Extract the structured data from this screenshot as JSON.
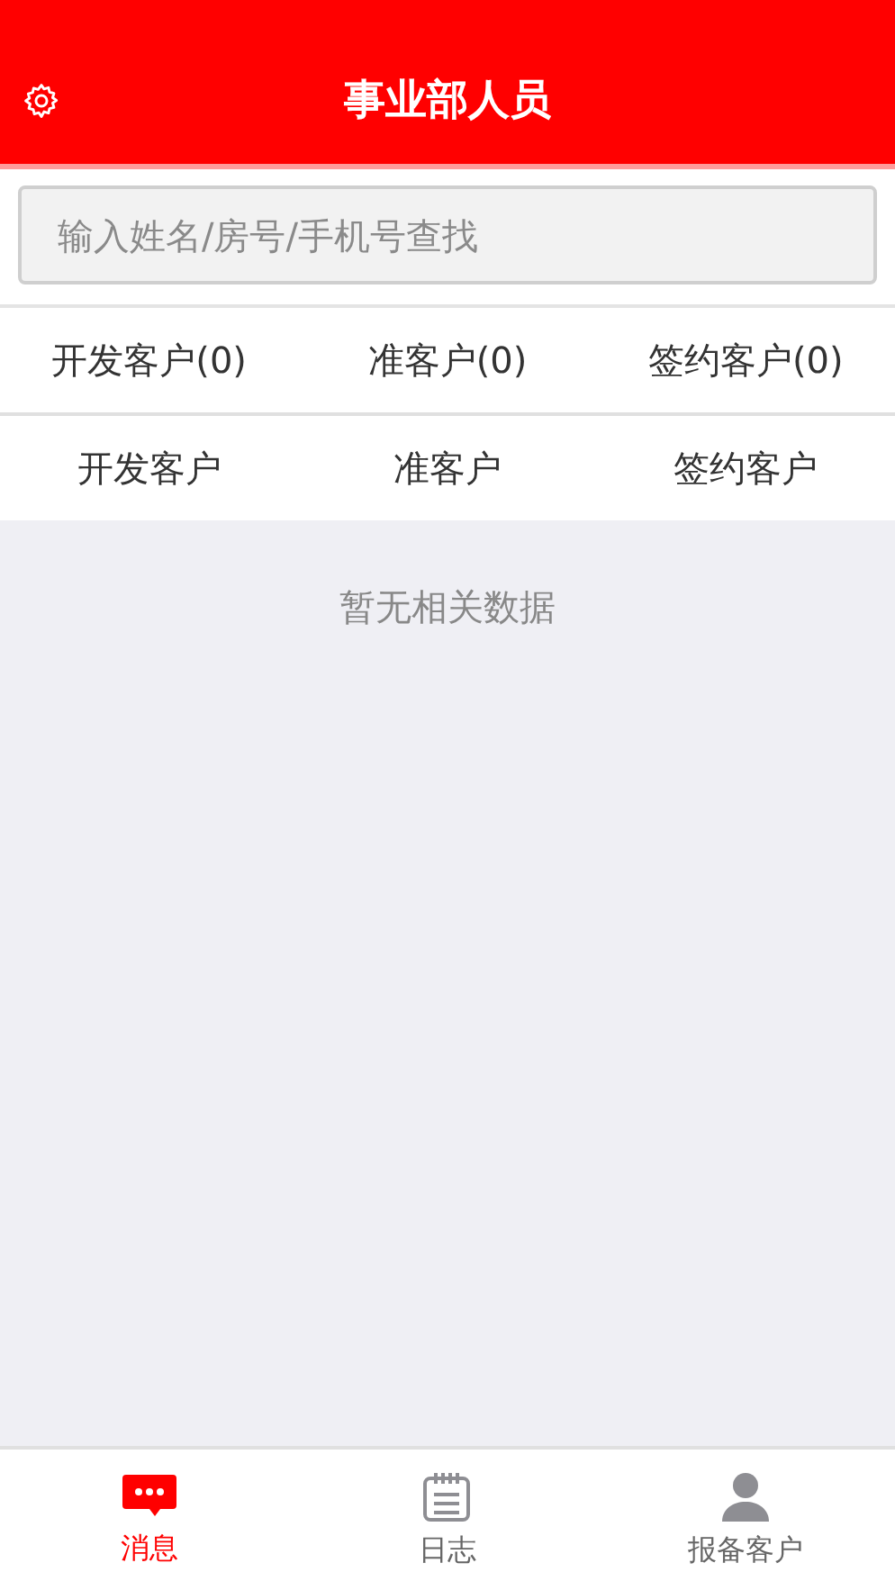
{
  "header": {
    "title": "事业部人员"
  },
  "search": {
    "placeholder": "输入姓名/房号/手机号查找"
  },
  "counts": [
    "开发客户(0)",
    "准客户(0)",
    "签约客户(0)"
  ],
  "tabs": [
    "开发客户",
    "准客户",
    "签约客户"
  ],
  "empty_message": "暂无相关数据",
  "bottom_nav": [
    {
      "label": "消息",
      "selected": true
    },
    {
      "label": "日志",
      "selected": false
    },
    {
      "label": "报备客户",
      "selected": false
    }
  ]
}
